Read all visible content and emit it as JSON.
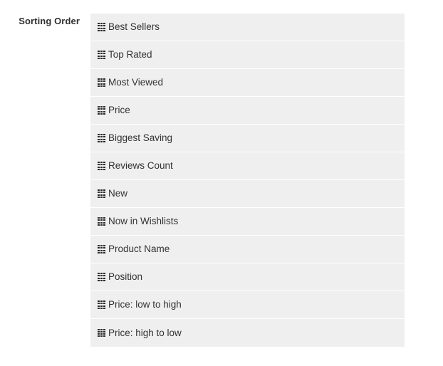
{
  "field": {
    "label": "Sorting Order",
    "handle_icon": "drag-handle-icon"
  },
  "colors": {
    "row_background": "#efefef",
    "row_separator": "#ffffff",
    "label_text": "#303030",
    "item_text": "#333333",
    "handle_dot": "#2b2b2b",
    "page_background": "#ffffff"
  },
  "sorting_order": {
    "items": [
      {
        "label": "Best Sellers"
      },
      {
        "label": "Top Rated"
      },
      {
        "label": "Most Viewed"
      },
      {
        "label": "Price"
      },
      {
        "label": "Biggest Saving"
      },
      {
        "label": "Reviews Count"
      },
      {
        "label": "New"
      },
      {
        "label": "Now in Wishlists"
      },
      {
        "label": "Product Name"
      },
      {
        "label": "Position"
      },
      {
        "label": "Price: low to high"
      },
      {
        "label": "Price: high to low"
      }
    ]
  }
}
